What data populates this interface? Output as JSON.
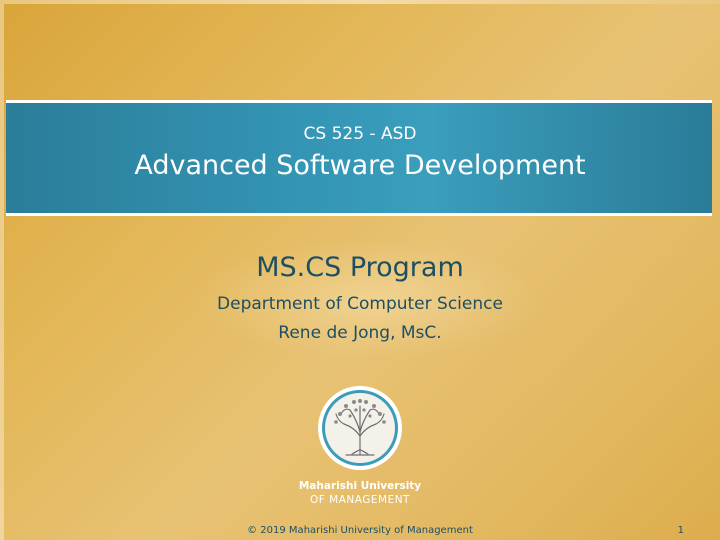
{
  "slide": {
    "course_code": "CS 525 - ASD",
    "course_title": "Advanced Software Development",
    "program": "MS.CS Program",
    "department": "Department of Computer Science",
    "presenter": "Rene de Jong, MsC.",
    "university_name": "Maharishi University",
    "university_sub": "OF MANAGEMENT",
    "footer": "© 2019 Maharishi University of Management",
    "page_number": "1",
    "logo_icon": "tree-of-life-icon"
  },
  "colors": {
    "background_gold": "#e3b757",
    "band_teal": "#3394b3",
    "text_dark_teal": "#1d4f63"
  }
}
